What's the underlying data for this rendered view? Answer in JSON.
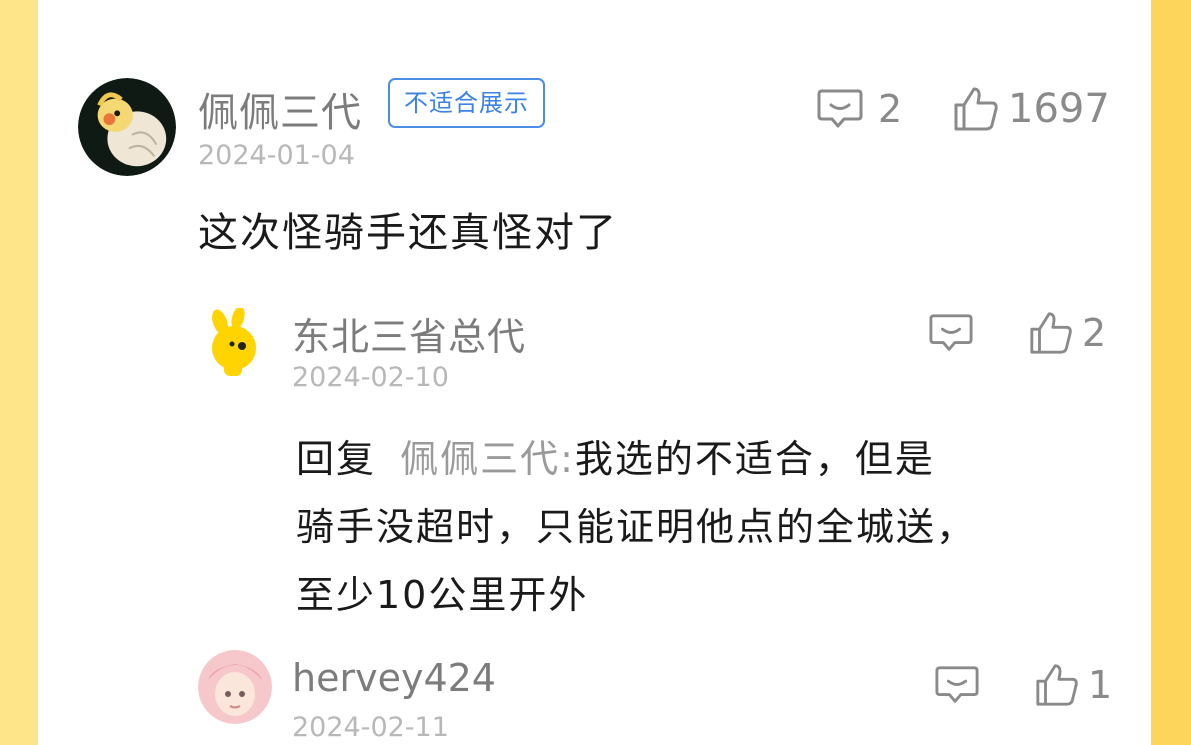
{
  "comment_main": {
    "username": "佩佩三代",
    "badge": "不适合展示",
    "date": "2024-01-04",
    "reply_count": "2",
    "like_count": "1697",
    "text": "这次怪骑手还真怪对了"
  },
  "reply_1": {
    "username": "东北三省总代",
    "date": "2024-02-10",
    "like_count": "2",
    "reply_label": "回复",
    "reply_target": "佩佩三代:",
    "text_line1": "我选的不适合，但是",
    "text_line2": "骑手没超时，只能证明他点的全城送，",
    "text_line3": "至少10公里开外"
  },
  "reply_2": {
    "username": "hervey424",
    "date": "2024-02-11",
    "like_count": "1"
  },
  "icons": {
    "comment": "comment-bubble-icon",
    "like": "thumbs-up-icon"
  },
  "colors": {
    "page_bg": "#fdd85a",
    "badge_blue": "#3b82e6",
    "username_gray": "#7c7c7c",
    "date_gray": "#b8b8b8"
  }
}
